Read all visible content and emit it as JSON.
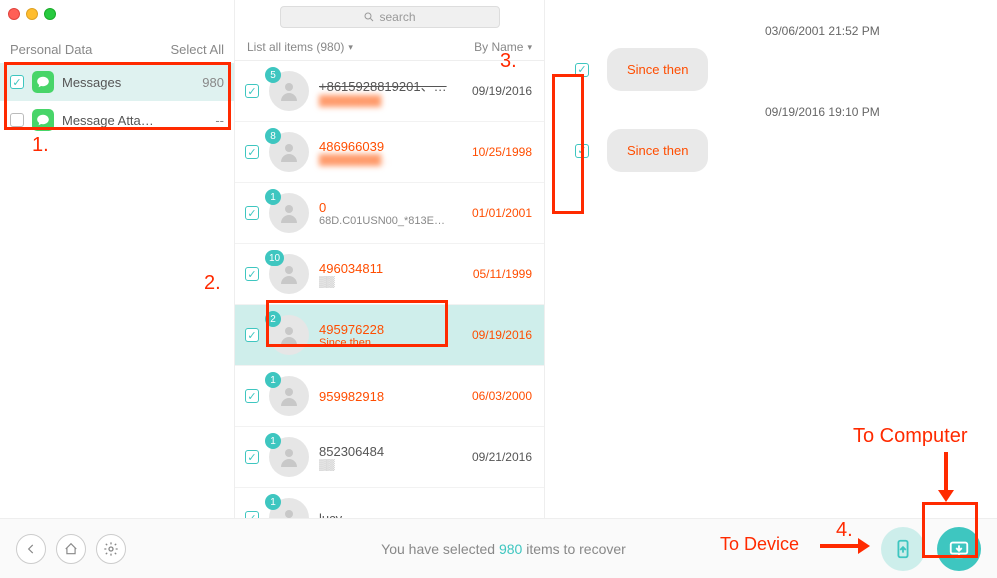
{
  "sidebar": {
    "header_label": "Personal Data",
    "select_all_label": "Select All",
    "items": [
      {
        "label": "Messages",
        "count": "980"
      },
      {
        "label": "Message Atta…",
        "count": "--"
      }
    ]
  },
  "search": {
    "placeholder": "search"
  },
  "list_header": {
    "list_label": "List all items (980)",
    "sort_label": "By Name"
  },
  "conversations": [
    {
      "badge": "5",
      "name": "+8615928819201、…",
      "name_style": "struck",
      "sub": "████████",
      "sub_style": "blur",
      "date": "09/19/2016",
      "date_style": "black"
    },
    {
      "badge": "8",
      "name": "486966039",
      "sub": "████████ .",
      "sub_style": "blur",
      "date": "10/25/1998"
    },
    {
      "badge": "1",
      "name": "0",
      "sub": "68D.C01USN00_*813E…",
      "date": "01/01/2001"
    },
    {
      "badge": "10",
      "name": "496034811",
      "sub": "▒▒",
      "date": "05/11/1999"
    },
    {
      "badge": "2",
      "name": "495976228",
      "sub": "Since then",
      "sub_style": "orange",
      "date": "09/19/2016",
      "selected": true
    },
    {
      "badge": "1",
      "name": "959982918",
      "sub": "",
      "date": "06/03/2000"
    },
    {
      "badge": "1",
      "name": "852306484",
      "name_style": "black",
      "sub": "▒▒",
      "date": "09/21/2016",
      "date_style": "black"
    },
    {
      "badge": "1",
      "name": "lucy",
      "name_style": "black",
      "sub": "",
      "date": ""
    }
  ],
  "detail": {
    "messages": [
      {
        "timestamp": "03/06/2001 21:52 PM",
        "text": "Since then"
      },
      {
        "timestamp": "09/19/2016 19:10 PM",
        "text": "Since then"
      }
    ]
  },
  "footer": {
    "text_before": "You have selected ",
    "count": "980",
    "text_after": " items to recover"
  },
  "annotations": {
    "n1": "1.",
    "n2": "2.",
    "n3": "3.",
    "n4": "4.",
    "to_device": "To Device",
    "to_computer": "To Computer"
  }
}
